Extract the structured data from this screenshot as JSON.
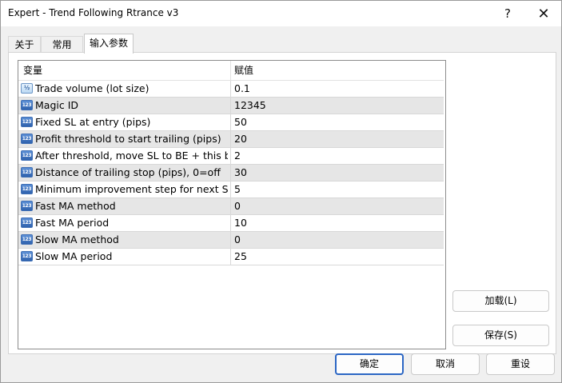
{
  "window": {
    "title": "Expert - Trend Following Rtrance v3",
    "help_glyph": "?",
    "close_glyph": "✕"
  },
  "tabs": [
    {
      "label": "关于"
    },
    {
      "label": "常用"
    },
    {
      "label": "输入参数"
    }
  ],
  "grid": {
    "headers": {
      "variable": "变量",
      "value": "赋值"
    },
    "rows": [
      {
        "icon": "fraction-icon",
        "icon_text": "½",
        "name": "Trade volume (lot size)",
        "value": "0.1"
      },
      {
        "icon": "integer-icon",
        "icon_text": "123",
        "name": "Magic ID",
        "value": "12345"
      },
      {
        "icon": "integer-icon",
        "icon_text": "123",
        "name": "Fixed SL at entry (pips)",
        "value": "50"
      },
      {
        "icon": "integer-icon",
        "icon_text": "123",
        "name": "Profit threshold to start trailing (pips)",
        "value": "20"
      },
      {
        "icon": "integer-icon",
        "icon_text": "123",
        "name": "After threshold, move SL to BE + this b...",
        "value": "2"
      },
      {
        "icon": "integer-icon",
        "icon_text": "123",
        "name": "Distance of trailing stop (pips), 0=off",
        "value": "30"
      },
      {
        "icon": "integer-icon",
        "icon_text": "123",
        "name": "Minimum improvement step for next SL...",
        "value": "5"
      },
      {
        "icon": "integer-icon",
        "icon_text": "123",
        "name": "Fast MA method",
        "value": "0"
      },
      {
        "icon": "integer-icon",
        "icon_text": "123",
        "name": "Fast MA period",
        "value": "10"
      },
      {
        "icon": "integer-icon",
        "icon_text": "123",
        "name": "Slow MA method",
        "value": "0"
      },
      {
        "icon": "integer-icon",
        "icon_text": "123",
        "name": "Slow MA period",
        "value": "25"
      }
    ]
  },
  "buttons": {
    "load": "加载(L)",
    "save": "保存(S)",
    "ok": "确定",
    "cancel": "取消",
    "reset": "重设"
  },
  "colors": {
    "accent": "#2b66c4",
    "alt_row": "#e6e6e6"
  }
}
